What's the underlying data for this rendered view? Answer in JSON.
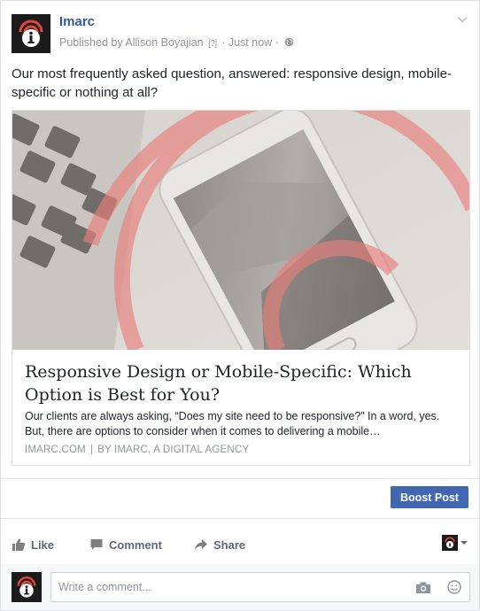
{
  "post": {
    "page_name": "Imarc",
    "published_by": "Published by Allison Boyajian",
    "help_marker": "[?]",
    "separator": "·",
    "timestamp": "Just now ·",
    "text": "Our most frequently asked question, answered: responsive design, mobile-specific or nothing at all?"
  },
  "link": {
    "title": "Responsive Design or Mobile-Specific: Which Option is Best for You?",
    "description": "Our clients are always asking, “Does my site need to be responsive?” In a word, yes. But, there are options to consider when it comes to delivering a mobile…",
    "domain": "IMARC.COM",
    "source_separator": "|",
    "byline": "BY IMARC, A DIGITAL AGENCY"
  },
  "boost": {
    "label": "Boost Post"
  },
  "actions": {
    "like": "Like",
    "comment": "Comment",
    "share": "Share"
  },
  "composer": {
    "placeholder": "Write a comment..."
  },
  "icons": {
    "avatar": "imarc-logo-icon",
    "globe": "globe-icon",
    "chevron": "chevron-down-icon",
    "like": "thumbs-up-icon",
    "comment": "comment-icon",
    "share": "share-icon",
    "camera": "camera-icon",
    "emoji": "smiley-icon"
  },
  "colors": {
    "link_blue": "#365899",
    "button_blue": "#4267b2",
    "muted_text": "#90949c",
    "action_text": "#606770"
  }
}
